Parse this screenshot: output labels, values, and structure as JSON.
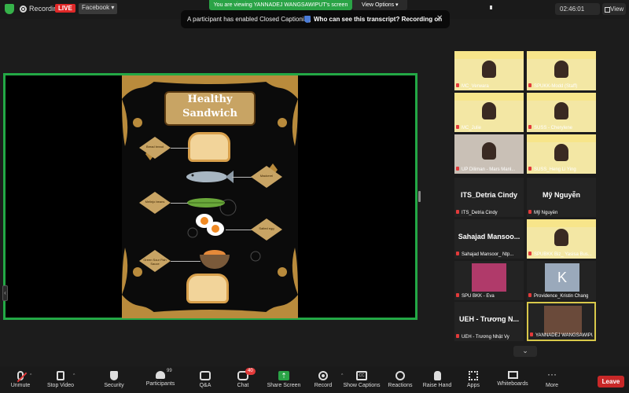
{
  "top_bar": {
    "recording_label": "Recording",
    "live_badge": "LIVE",
    "platform_select": "Facebook ▾",
    "viewing_banner": "You are viewing YANNADEJ WANGSAWIPUT's screen",
    "view_options": "View Options ▾",
    "cc_notice": "A participant has enabled Closed Captioning",
    "cc_link": "Who can see this transcript? Recording on",
    "clock": "02:46:01",
    "view_label": "View"
  },
  "slide": {
    "title_line1": "Healthy",
    "title_line2": "Sandwich",
    "labels": [
      "Bread bread",
      "Mackerel",
      "Melinjo beans",
      "Salted egg",
      "Green Sour Fish Sauce"
    ]
  },
  "gallery": [
    {
      "name": "MC_Verwara",
      "kind": "yellow"
    },
    {
      "name": "SPUKK-Modd (Staff)",
      "kind": "yellow"
    },
    {
      "name": "MC_Julie",
      "kind": "yellow"
    },
    {
      "name": "SUSS - Cherylene",
      "kind": "yellow"
    },
    {
      "name": "UP Diliman - Mars Manl...",
      "kind": "room"
    },
    {
      "name": "SUSS_Heng Li Ying",
      "kind": "yellow"
    },
    {
      "name": "ITS_Detria Cindy",
      "kind": "text",
      "big": "ITS_Detria Cindy"
    },
    {
      "name": "Mỹ Nguyễn",
      "kind": "text",
      "big": "Mỹ Nguyễn"
    },
    {
      "name": "Sahajad Mansoor_ Ntp...",
      "kind": "text",
      "big": "Sahajad Mansoo..."
    },
    {
      "name": "SPUBKK Biz_ Yasisa Bus...",
      "kind": "yellow"
    },
    {
      "name": "SPU BKK - Eva",
      "kind": "stage"
    },
    {
      "name": "Providence_Kristin Chang",
      "kind": "avatar",
      "big": "K"
    },
    {
      "name": "UEH - Trương Nhật Vy",
      "kind": "text",
      "big": "UEH - Trương N..."
    },
    {
      "name": "YANNADEJ WANGSAWIPUT",
      "kind": "cam"
    }
  ],
  "toolbar": {
    "unmute": "Unmute",
    "stop_video": "Stop Video",
    "security": "Security",
    "participants": "Participants",
    "participants_count": "99",
    "qa": "Q&A",
    "chat": "Chat",
    "chat_badge": "40",
    "share_screen": "Share Screen",
    "record": "Record",
    "show_captions": "Show Captions",
    "reactions": "Reactions",
    "raise_hand": "Raise Hand",
    "apps": "Apps",
    "whiteboards": "Whiteboards",
    "more": "More",
    "leave": "Leave"
  },
  "colors": {
    "share_border": "#23a845",
    "live": "#e02828",
    "leave": "#c82828",
    "active_speaker": "#d8c84a"
  }
}
